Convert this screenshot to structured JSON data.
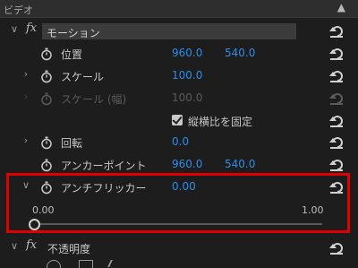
{
  "panel": {
    "title": "ビデオ",
    "collapse_icon": "chevron-up-icon"
  },
  "motion": {
    "fx": "fx",
    "name": "モーション",
    "position": {
      "label": "位置",
      "x": "960.0",
      "y": "540.0"
    },
    "scale": {
      "label": "スケール",
      "value": "100.0"
    },
    "scale_width": {
      "label": "スケール (幅)",
      "value": "100.0"
    },
    "uniform_scale": {
      "label": "縦横比を固定",
      "checked": true
    },
    "rotation": {
      "label": "回転",
      "value": "0.0"
    },
    "anchor": {
      "label": "アンカーポイント",
      "x": "960.0",
      "y": "540.0"
    },
    "antiflicker": {
      "label": "アンチフリッカー",
      "value": "0.00",
      "slider_min": "0.00",
      "slider_max": "1.00",
      "slider_level": 0
    }
  },
  "opacity": {
    "fx": "fx",
    "name": "不透明度"
  },
  "colors": {
    "value_blue": "#2d8ceb",
    "highlight_red": "#e00000",
    "background": "#1d1d1d"
  }
}
